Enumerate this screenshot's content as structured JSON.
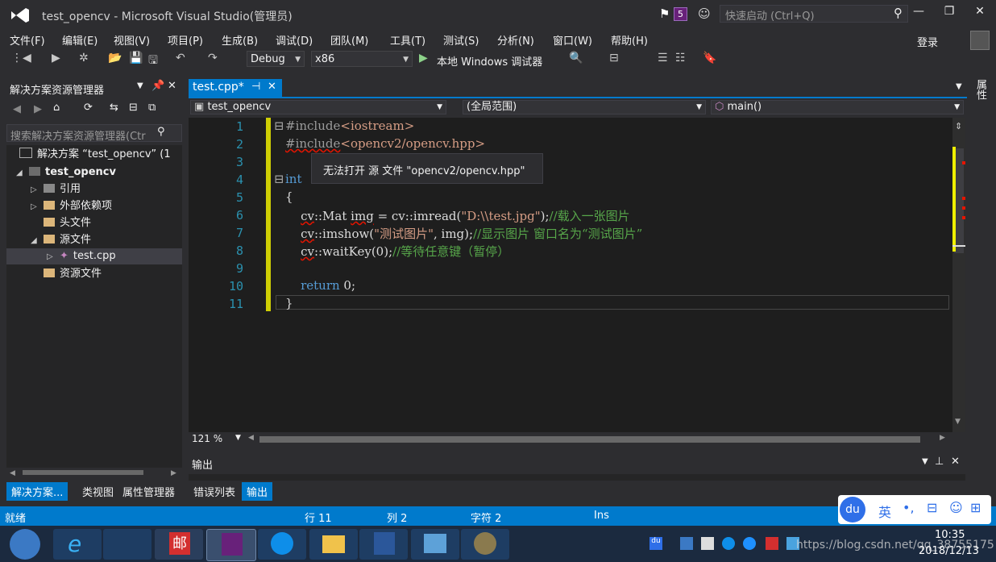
{
  "window": {
    "title": "test_opencv - Microsoft Visual Studio(管理员)",
    "notification_count": "5",
    "quick_launch_placeholder": "快速启动 (Ctrl+Q)",
    "login": "登录"
  },
  "menu": [
    "文件(F)",
    "编辑(E)",
    "视图(V)",
    "项目(P)",
    "生成(B)",
    "调试(D)",
    "团队(M)",
    "工具(T)",
    "测试(S)",
    "分析(N)",
    "窗口(W)",
    "帮助(H)"
  ],
  "toolbar": {
    "config": "Debug",
    "platform": "x86",
    "debugger": "本地 Windows 调试器"
  },
  "solution_explorer": {
    "title": "解决方案资源管理器",
    "search_placeholder": "搜索解决方案资源管理器(Ctr",
    "tree": [
      {
        "label": "解决方案 “test_opencv” (1",
        "indent": 0,
        "expander": ""
      },
      {
        "label": "test_opencv",
        "indent": 0,
        "expander": "◢"
      },
      {
        "label": "引用",
        "indent": 1,
        "expander": "▷"
      },
      {
        "label": "外部依赖项",
        "indent": 1,
        "expander": "▷"
      },
      {
        "label": "头文件",
        "indent": 1,
        "expander": ""
      },
      {
        "label": "源文件",
        "indent": 1,
        "expander": "◢"
      },
      {
        "label": "test.cpp",
        "indent": 2,
        "expander": "▷"
      },
      {
        "label": "资源文件",
        "indent": 1,
        "expander": ""
      }
    ]
  },
  "bottom_tabs": [
    "解决方案...",
    "类视图",
    "属性管理器",
    "错误列表",
    "输出"
  ],
  "editor": {
    "tab_label": "test.cpp*",
    "nav_project": "test_opencv",
    "nav_scope": "(全局范围)",
    "nav_member": "main()",
    "zoom": "121 %",
    "tooltip": "无法打开 源 文件 \"opencv2/opencv.hpp\"",
    "lines": [
      "1",
      "2",
      "3",
      "4",
      "5",
      "6",
      "7",
      "8",
      "9",
      "10",
      "11"
    ]
  },
  "output_panel": {
    "title": "输出"
  },
  "side_panel": {
    "label": "属性"
  },
  "status": {
    "ready": "就绪",
    "line": "行 11",
    "col": "列 2",
    "char": "字符 2",
    "mode": "Ins"
  },
  "clock": {
    "time": "10:35",
    "date": "2018/12/13"
  },
  "watermark": "https://blog.csdn.net/qq_38755175",
  "ime": {
    "lang": "英"
  },
  "colors": {
    "accent": "#007acc",
    "keyword": "#569cd6",
    "string": "#d69d85",
    "comment": "#57a64a",
    "line_number": "#2b91af"
  }
}
